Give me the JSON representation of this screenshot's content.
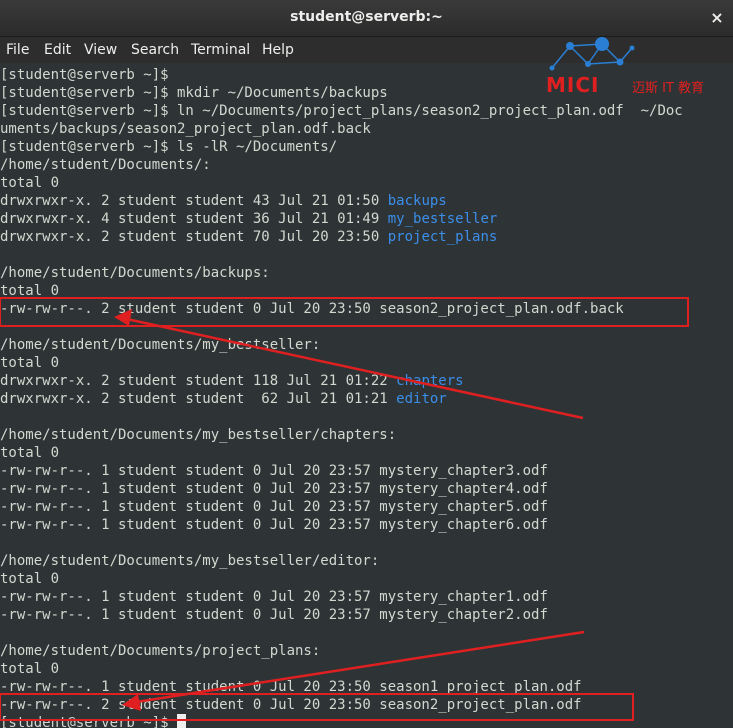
{
  "window": {
    "title": "student@serverb:~",
    "close_glyph": "×"
  },
  "menu": [
    "File",
    "Edit",
    "View",
    "Search",
    "Terminal",
    "Help"
  ],
  "watermark": {
    "brand": "MICI",
    "subtitle": "迈斯 IT 教育"
  },
  "terminal": {
    "lines": [
      {
        "text": "[student@serverb ~]$"
      },
      {
        "text": "[student@serverb ~]$ mkdir ~/Documents/backups"
      },
      {
        "text": "[student@serverb ~]$ ln ~/Documents/project_plans/season2_project_plan.odf  ~/Doc"
      },
      {
        "text": "uments/backups/season2_project_plan.odf.back"
      },
      {
        "text": "[student@serverb ~]$ ls -lR ~/Documents/"
      },
      {
        "text": "/home/student/Documents/:"
      },
      {
        "text": "total 0"
      },
      {
        "text": "drwxrwxr-x. 2 student student 43 Jul 21 01:50 ",
        "dir": "backups"
      },
      {
        "text": "drwxrwxr-x. 4 student student 36 Jul 21 01:49 ",
        "dir": "my_bestseller"
      },
      {
        "text": "drwxrwxr-x. 2 student student 70 Jul 20 23:50 ",
        "dir": "project_plans"
      },
      {
        "text": ""
      },
      {
        "text": "/home/student/Documents/backups:"
      },
      {
        "text": "total 0"
      },
      {
        "text": "-rw-rw-r--. 2 student student 0 Jul 20 23:50 season2_project_plan.odf.back"
      },
      {
        "text": ""
      },
      {
        "text": "/home/student/Documents/my_bestseller:"
      },
      {
        "text": "total 0"
      },
      {
        "text": "drwxrwxr-x. 2 student student 118 Jul 21 01:22 ",
        "dir": "chapters"
      },
      {
        "text": "drwxrwxr-x. 2 student student  62 Jul 21 01:21 ",
        "dir": "editor"
      },
      {
        "text": ""
      },
      {
        "text": "/home/student/Documents/my_bestseller/chapters:"
      },
      {
        "text": "total 0"
      },
      {
        "text": "-rw-rw-r--. 1 student student 0 Jul 20 23:57 mystery_chapter3.odf"
      },
      {
        "text": "-rw-rw-r--. 1 student student 0 Jul 20 23:57 mystery_chapter4.odf"
      },
      {
        "text": "-rw-rw-r--. 1 student student 0 Jul 20 23:57 mystery_chapter5.odf"
      },
      {
        "text": "-rw-rw-r--. 1 student student 0 Jul 20 23:57 mystery_chapter6.odf"
      },
      {
        "text": ""
      },
      {
        "text": "/home/student/Documents/my_bestseller/editor:"
      },
      {
        "text": "total 0"
      },
      {
        "text": "-rw-rw-r--. 1 student student 0 Jul 20 23:57 mystery_chapter1.odf"
      },
      {
        "text": "-rw-rw-r--. 1 student student 0 Jul 20 23:57 mystery_chapter2.odf"
      },
      {
        "text": ""
      },
      {
        "text": "/home/student/Documents/project_plans:"
      },
      {
        "text": "total 0"
      },
      {
        "text": "-rw-rw-r--. 1 student student 0 Jul 20 23:50 season1_project_plan.odf"
      },
      {
        "text": "-rw-rw-r--. 2 student student 0 Jul 20 23:50 season2_project_plan.odf"
      },
      {
        "text": "[student@serverb ~]$ ",
        "cursor": true
      }
    ]
  },
  "colors": {
    "background": "#2e3436",
    "foreground": "#d3d7cf",
    "directory": "#3b8eea",
    "annotation": "#e02020"
  }
}
